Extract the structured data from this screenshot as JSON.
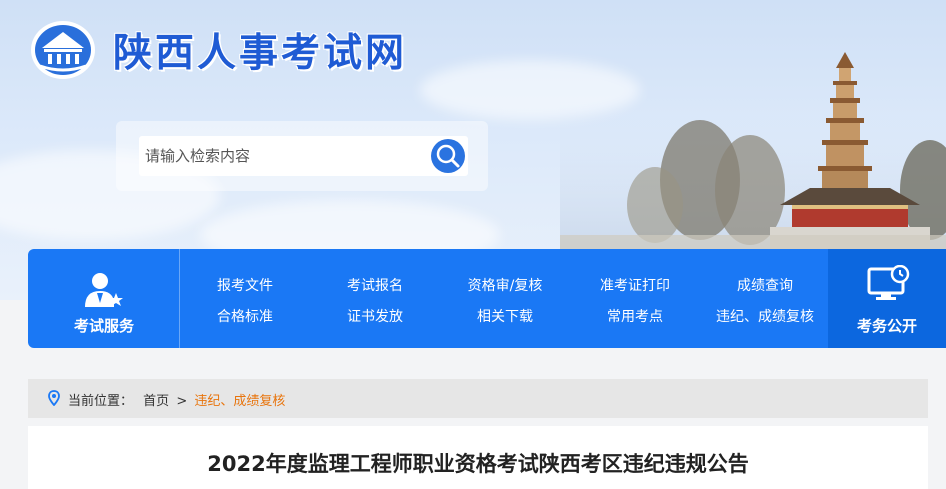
{
  "header": {
    "site_title": "陕西人事考试网",
    "search": {
      "placeholder": "请输入检索内容"
    }
  },
  "nav": {
    "left_label": "考试服务",
    "right_label": "考务公开",
    "items": [
      {
        "label": "报考文件"
      },
      {
        "label": "考试报名"
      },
      {
        "label": "资格审/复核"
      },
      {
        "label": "准考证打印"
      },
      {
        "label": "成绩查询"
      },
      {
        "label": "合格标准"
      },
      {
        "label": "证书发放"
      },
      {
        "label": "相关下载"
      },
      {
        "label": "常用考点"
      },
      {
        "label": "违纪、成绩复核"
      }
    ]
  },
  "breadcrumb": {
    "prefix": "当前位置：",
    "home": "首页",
    "separator": ">",
    "current": "违纪、成绩复核"
  },
  "article": {
    "title": "2022年度监理工程师职业资格考试陕西考区违纪违规公告"
  },
  "colors": {
    "nav_blue": "#1a78f5",
    "nav_dark_blue": "#0c67df",
    "title_blue": "#1f5bd4",
    "breadcrumb_current": "#e8740c"
  }
}
